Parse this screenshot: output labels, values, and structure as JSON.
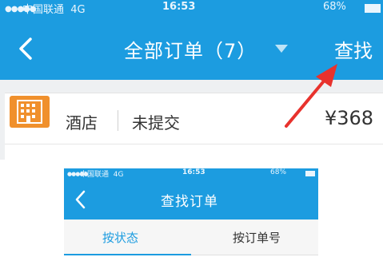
{
  "top_screen": {
    "status_bar": {
      "signal": "●●●●●",
      "carrier": "中国联通",
      "network": "4G",
      "time": "16:53",
      "battery": "68%"
    },
    "nav": {
      "back_icon": "chevron-left-icon",
      "title": "全部订单（7）",
      "dropdown_icon": "caret-down-icon",
      "search_label": "查找"
    },
    "order": {
      "icon": "hotel-building-icon",
      "type": "酒店",
      "status": "未提交",
      "price": "¥368"
    },
    "annotation_arrow_color": "#e8322d"
  },
  "bottom_screen": {
    "status_bar": {
      "signal": "●●●●●",
      "carrier": "中国联通",
      "network": "4G",
      "time": "16:53",
      "battery": "68%"
    },
    "nav": {
      "back_icon": "chevron-left-icon",
      "title": "查找订单"
    },
    "tabs": [
      {
        "label": "按状态",
        "active": true
      },
      {
        "label": "按订单号",
        "active": false
      }
    ]
  },
  "colors": {
    "brand_blue": "#1c9ce0",
    "hotel_orange": "#f0902c"
  }
}
